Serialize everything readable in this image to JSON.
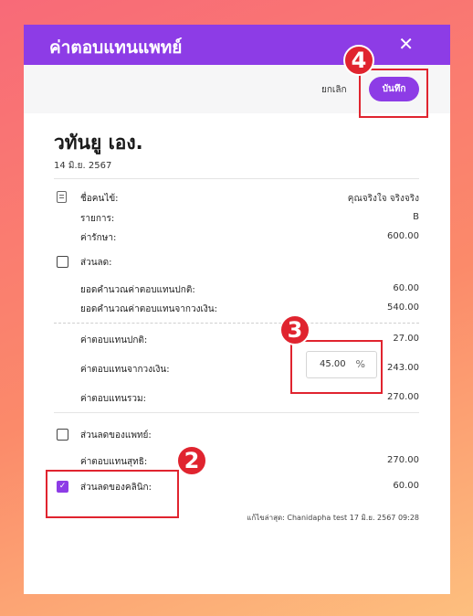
{
  "dialog": {
    "title": "ค่าตอบแทนแพทย์",
    "close_glyph": "✕",
    "cancel_label": "ยกเลิก",
    "save_label": "บันทึก"
  },
  "patient": {
    "name": "วทันยู เอง.",
    "date": "14 มิ.ย. 2567"
  },
  "info": {
    "patient_label": "ชื่อคนไข้:",
    "patient_value": "คุณจริงใจ จริงจริง",
    "item_label": "รายการ:",
    "item_value": "B",
    "fee_label": "ค่ารักษา:",
    "fee_value": "600.00"
  },
  "discount": {
    "label": "ส่วนลด:",
    "checked": false,
    "normal_base_label": "ยอดคำนวณค่าตอบแทนปกติ:",
    "normal_base_value": "60.00",
    "fraction_base_label": "ยอดคำนวณค่าตอบแทนจากวงเงิน:",
    "fraction_base_value": "540.00"
  },
  "compensation": {
    "normal_label": "ค่าตอบแทนปกติ:",
    "normal_value": "27.00",
    "fraction_label": "ค่าตอบแทนจากวงเงิน:",
    "fraction_percent": "45.00",
    "percent_unit": "%",
    "fraction_value": "243.00",
    "total_label": "ค่าตอบแทนรวม:",
    "total_value": "270.00"
  },
  "doctor_discount": {
    "label": "ส่วนลดของแพทย์:",
    "checked": false,
    "net_label": "ค่าตอบแทนสุทธิ:",
    "net_value": "270.00"
  },
  "clinic_discount": {
    "label": "ส่วนลดของคลินิก:",
    "checked": true,
    "value": "60.00"
  },
  "footer": {
    "last_edited": "แก้ไขล่าสุด: Chanidapha test 17 มิ.ย. 2567 09:28"
  },
  "annotations": {
    "badge_2": "2",
    "badge_3": "3",
    "badge_4": "4"
  },
  "colors": {
    "accent": "#8d3ce6",
    "annotation": "#e0242f"
  }
}
